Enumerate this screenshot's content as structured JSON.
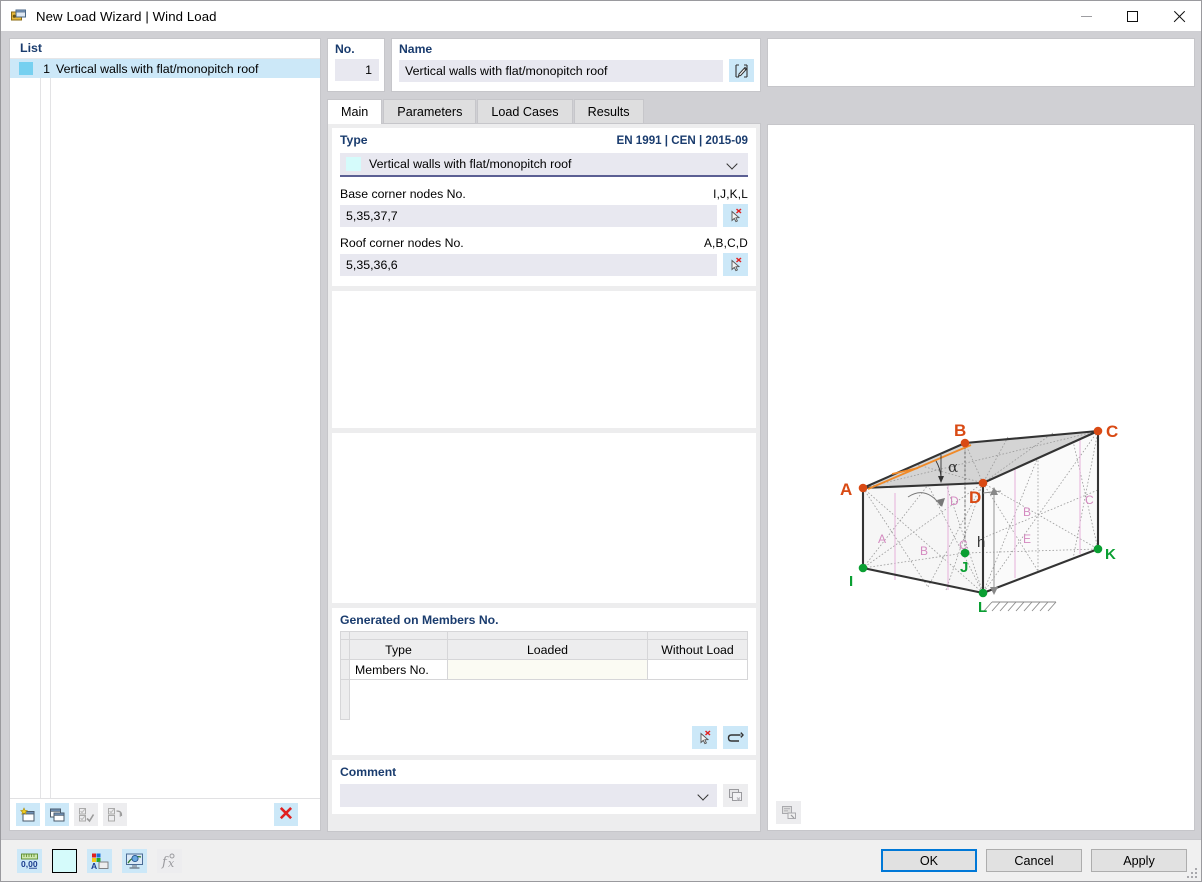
{
  "window": {
    "title": "New Load Wizard | Wind Load",
    "icon": "wizard-icon",
    "minimize_label": "Minimize",
    "maximize_label": "Maximize",
    "close_label": "Close"
  },
  "list_panel": {
    "header": "List",
    "rows": [
      {
        "number": "1",
        "label": "Vertical walls with flat/monopitch roof",
        "swatch_color": "#76d0f0",
        "selected": true
      }
    ],
    "toolbar": [
      {
        "name": "new-item-button",
        "label": "New",
        "enabled": true
      },
      {
        "name": "copy-item-button",
        "label": "Copy",
        "enabled": true
      },
      {
        "name": "select-all-button",
        "label": "Select All",
        "enabled": false
      },
      {
        "name": "invert-selection-button",
        "label": "Invert Selection",
        "enabled": false
      },
      {
        "name": "delete-item-button",
        "label": "Delete",
        "enabled": true
      }
    ]
  },
  "header": {
    "no_label": "No.",
    "no_value": "1",
    "name_label": "Name",
    "name_value": "Vertical walls with flat/monopitch roof",
    "edit_name_button": "Edit Name"
  },
  "tabs": [
    {
      "label": "Main",
      "active": true
    },
    {
      "label": "Parameters",
      "active": false
    },
    {
      "label": "Load Cases",
      "active": false
    },
    {
      "label": "Results",
      "active": false
    }
  ],
  "main_tab": {
    "type_section": {
      "title": "Type",
      "standard": "EN 1991 | CEN | 2015-09",
      "selected_type": "Vertical walls with flat/monopitch roof",
      "swatch_color": "#d5fbfb"
    },
    "base_nodes": {
      "label": "Base corner nodes No.",
      "hint": "I,J,K,L",
      "value": "5,35,37,7",
      "pick_button": "Select Nodes"
    },
    "roof_nodes": {
      "label": "Roof corner nodes No.",
      "hint": "A,B,C,D",
      "value": "5,35,36,6",
      "pick_button": "Select Nodes"
    },
    "generated": {
      "title": "Generated on Members No.",
      "columns": [
        "",
        "Type",
        "Loaded",
        "Without Load"
      ],
      "rows": [
        {
          "type": "Members No.",
          "loaded": "",
          "without_load": ""
        }
      ],
      "pick_button": "Select Members",
      "reset_button": "Reset"
    },
    "comment": {
      "title": "Comment",
      "value": "",
      "placeholder": "",
      "copy_button": "Comment Templates"
    }
  },
  "graphic": {
    "roof_nodes": [
      "A",
      "B",
      "C",
      "D"
    ],
    "base_nodes": [
      "I",
      "J",
      "K",
      "L"
    ],
    "angle_label": "α",
    "height_label": "h",
    "roof_zone_label": "D",
    "front_zones": [
      "A",
      "B",
      "C"
    ],
    "side_zones": [
      "B",
      "E",
      "C"
    ],
    "node_color_roof": "#d94a14",
    "node_color_base": "#0a9f32",
    "ridge_color": "#f08a28",
    "zone_label_color": "#d48ac0",
    "screenshot_button": "Print Graphic"
  },
  "footer": {
    "tools": [
      {
        "name": "numeric-format-button",
        "label": "0,00",
        "enabled": true
      },
      {
        "name": "color-swatch-button",
        "label": "Color",
        "enabled": true
      },
      {
        "name": "display-properties-button",
        "label": "Display Properties",
        "enabled": true
      },
      {
        "name": "visual-preview-button",
        "label": "Visual Preview",
        "enabled": true
      },
      {
        "name": "formula-button",
        "label": "Formula",
        "enabled": false
      }
    ],
    "buttons": [
      {
        "name": "ok-button",
        "label": "OK",
        "primary": true
      },
      {
        "name": "cancel-button",
        "label": "Cancel",
        "primary": false
      },
      {
        "name": "apply-button",
        "label": "Apply",
        "primary": false
      }
    ]
  }
}
